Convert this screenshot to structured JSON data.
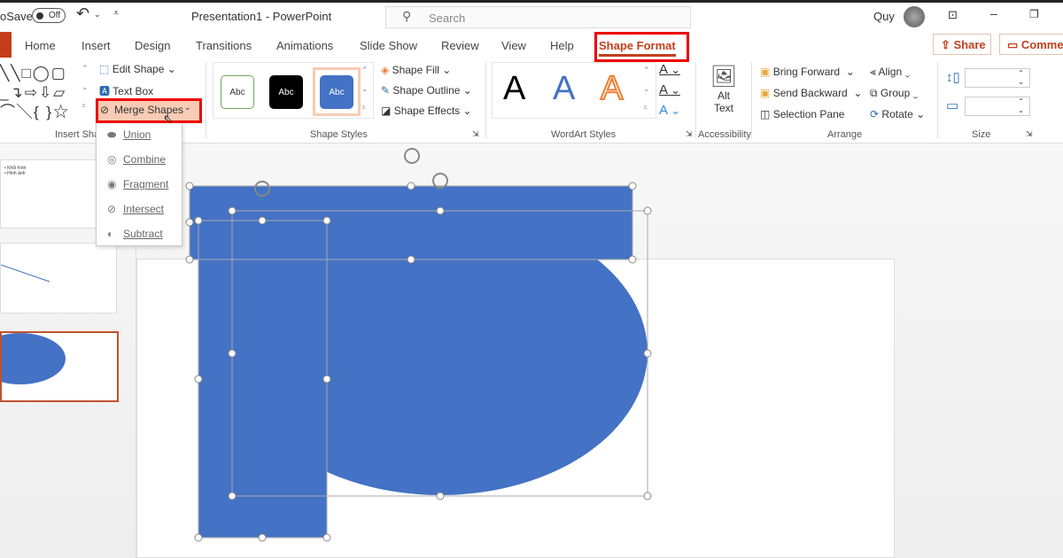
{
  "titlebar": {
    "autosave": "oSave",
    "toggle": "Off",
    "title": "Presentation1  -  PowerPoint",
    "search_placeholder": "Search",
    "user": "Quy"
  },
  "tabs": [
    "Home",
    "Insert",
    "Design",
    "Transitions",
    "Animations",
    "Slide Show",
    "Review",
    "View",
    "Help",
    "Shape Format"
  ],
  "actions": {
    "share": "Share",
    "comments": "Comme"
  },
  "ribbon": {
    "insert_shapes": {
      "edit_shape": "Edit Shape",
      "text_box": "Text Box",
      "merge_shapes": "Merge Shapes",
      "label": "Insert Sha"
    },
    "shape_styles": {
      "styles": [
        "Abc",
        "Abc",
        "Abc"
      ],
      "fill": "Shape Fill",
      "outline": "Shape Outline",
      "effects": "Shape Effects",
      "label": "Shape Styles"
    },
    "wordart": {
      "letters": [
        "A",
        "A",
        "A"
      ],
      "label": "WordArt Styles"
    },
    "accessibility": {
      "alt_text": "Alt Text",
      "label": "Accessibility"
    },
    "arrange": {
      "bring_forward": "Bring Forward",
      "send_backward": "Send Backward",
      "selection_pane": "Selection Pane",
      "align": "Align",
      "group": "Group",
      "rotate": "Rotate",
      "label": "Arrange"
    },
    "size": {
      "label": "Size",
      "height": "",
      "width": ""
    }
  },
  "merge_menu": [
    "Union",
    "Combine",
    "Fragment",
    "Intersect",
    "Subtract"
  ],
  "thumbnails": {
    "bullets": [
      "Khối hình",
      "Hình ảnh"
    ]
  },
  "colors": {
    "accent": "#c43e1c",
    "shape": "#4472c4",
    "highlight": "#e00000"
  }
}
